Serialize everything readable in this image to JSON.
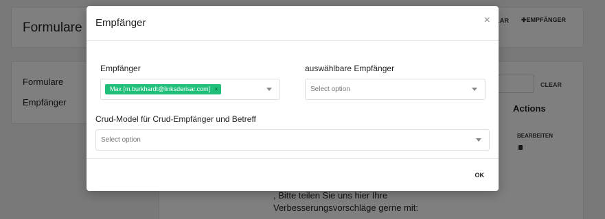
{
  "page": {
    "title": "Formulare",
    "header_clear": "LAR",
    "header_add": "EMPFÄNGER",
    "sidebar": [
      {
        "label": "Formulare"
      },
      {
        "label": "Empfänger"
      }
    ],
    "search_clear": "CLEAR",
    "actions_header": "Actions",
    "edit_label": "BEARBEITEN",
    "body_lines": [
      ", Bitte teilen Sie uns hier Ihre",
      "Verbesserungsvorschläge gerne mit:"
    ]
  },
  "modal": {
    "title": "Empfänger",
    "close_icon": "×",
    "recipients": {
      "label": "Empfänger",
      "selected": [
        {
          "label": "Max [m.burkhardt@linksderisar.com]",
          "remove": "×"
        }
      ]
    },
    "selectable_recipients": {
      "label": "auswählbare Empfänger",
      "placeholder": "Select option"
    },
    "crud_model": {
      "label": "Crud-Model für Crud-Empfänger und Betreff",
      "placeholder": "Select option"
    },
    "ok_label": "OK"
  },
  "colors": {
    "tag": "#1fbf7a",
    "overlay": "rgba(0,0,0,0.5)"
  }
}
